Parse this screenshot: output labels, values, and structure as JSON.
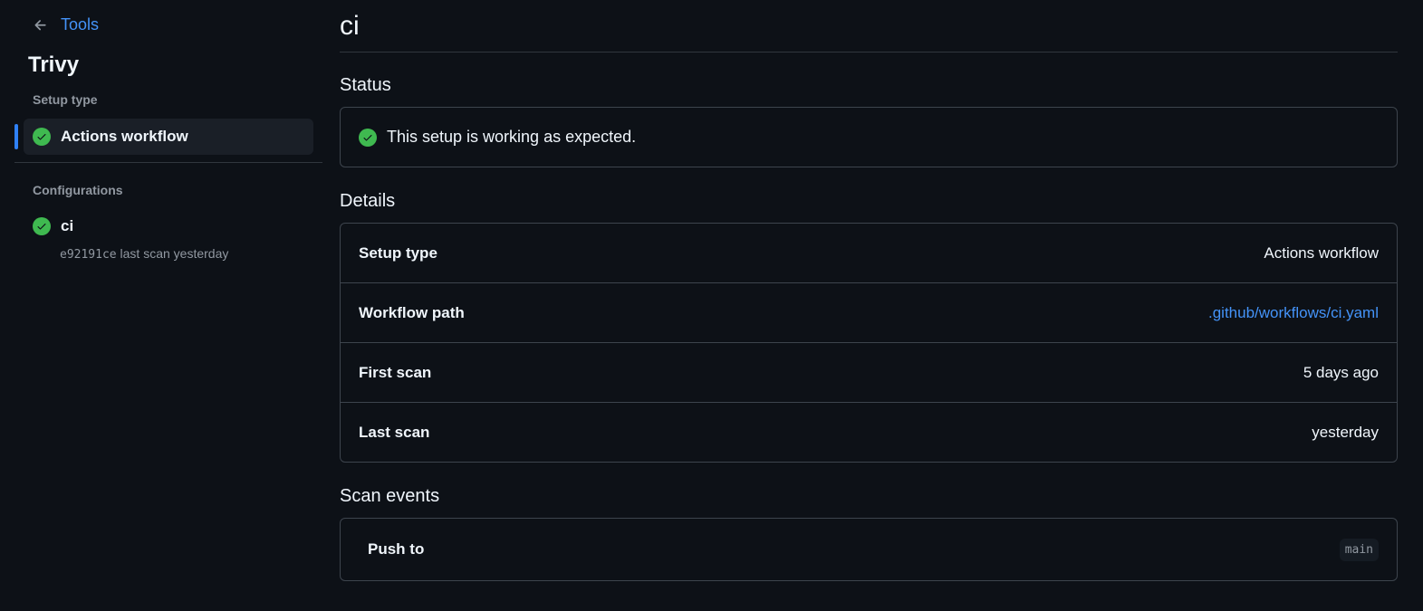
{
  "back_link": {
    "label": "Tools"
  },
  "tool_name": "Trivy",
  "sidebar": {
    "setup_type_label": "Setup type",
    "setup_item": {
      "label": "Actions workflow",
      "status": "success"
    },
    "configurations_label": "Configurations",
    "configurations": [
      {
        "name": "ci",
        "commit": "e92191ce",
        "meta": "last scan yesterday",
        "status": "success"
      }
    ]
  },
  "main": {
    "title": "ci",
    "status_heading": "Status",
    "status_message": "This setup is working as expected.",
    "details_heading": "Details",
    "details": [
      {
        "key": "Setup type",
        "value": "Actions workflow",
        "is_link": false
      },
      {
        "key": "Workflow path",
        "value": ".github/workflows/ci.yaml",
        "is_link": true
      },
      {
        "key": "First scan",
        "value": "5 days ago",
        "is_link": false
      },
      {
        "key": "Last scan",
        "value": "yesterday",
        "is_link": false
      }
    ],
    "events_heading": "Scan events",
    "events": [
      {
        "label": "Push to",
        "branch": "main"
      }
    ]
  },
  "colors": {
    "background": "#0d1117",
    "accent": "#4493f8",
    "success": "#3fb950",
    "border": "#3d444d"
  }
}
